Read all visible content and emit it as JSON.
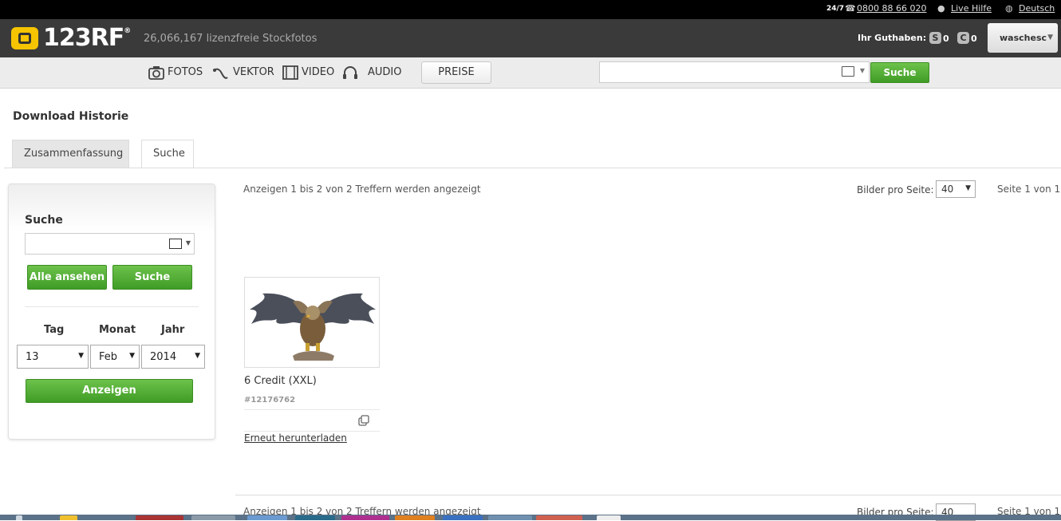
{
  "topbar": {
    "hours": "24/7",
    "phone": "0800 88 66 020",
    "live_help": "Live Hilfe",
    "language": "Deutsch"
  },
  "header": {
    "logo_text": "123RF",
    "logo_mark": "®",
    "tagline": "26,066,167  lizenzfreie Stockfotos",
    "credit_label": "Ihr Guthaben:",
    "subscription_badge": "S",
    "subscription_value": "0",
    "credits_badge": "C",
    "credits_value": "0",
    "username": "waschesc"
  },
  "nav": {
    "fotos": "FOTOS",
    "vektor": "VEKTOR",
    "video": "VIDEO",
    "audio": "AUDIO",
    "preise": "PREISE",
    "search_value": "",
    "search_button": "Suche"
  },
  "page": {
    "title": "Download Historie",
    "tabs": [
      {
        "label": "Zusammenfassung",
        "active": false
      },
      {
        "label": "Suche",
        "active": true
      }
    ]
  },
  "sidebar": {
    "title": "Suche",
    "search_value": "",
    "btn_all": "Alle ansehen",
    "btn_search": "Suche",
    "labels": {
      "day": "Tag",
      "month": "Monat",
      "year": "Jahr"
    },
    "day": "13",
    "month": "Feb",
    "year": "2014",
    "btn_show": "Anzeigen"
  },
  "results": {
    "info": "Anzeigen 1 bis 2 von 2 Treffern werden angezeigt",
    "per_page_label": "Bilder pro Seite:",
    "per_page": "40",
    "page_info": "Seite 1 von 1",
    "items": [
      {
        "credit": "6 Credit (XXL)",
        "id": "#12176762",
        "redownload": "Erneut herunterladen"
      }
    ]
  },
  "colors": {
    "green": "#4caf30",
    "header": "#3a3a3a",
    "logo_yellow": "#f6c400"
  }
}
